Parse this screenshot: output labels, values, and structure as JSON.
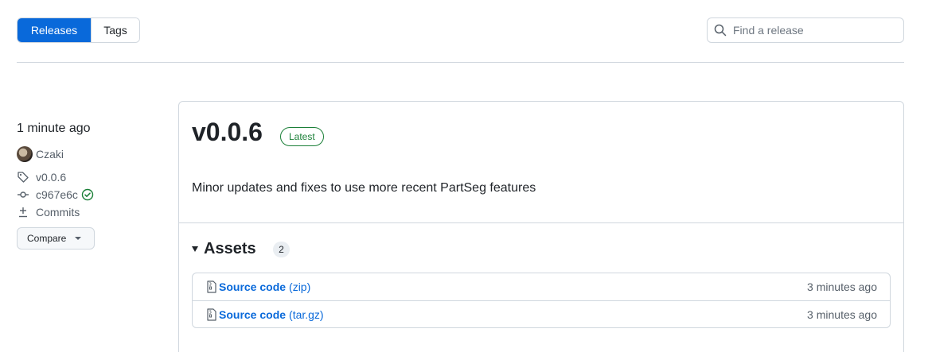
{
  "tabs": {
    "releases": "Releases",
    "tags": "Tags"
  },
  "search": {
    "placeholder": "Find a release"
  },
  "meta": {
    "time": "1 minute ago",
    "author": "Czaki",
    "tag": "v0.0.6",
    "commit": "c967e6c",
    "commits_label": "Commits",
    "compare_label": "Compare"
  },
  "release": {
    "version": "v0.0.6",
    "badge": "Latest",
    "description": "Minor updates and fixes to use more recent PartSeg features"
  },
  "assets": {
    "title": "Assets",
    "count": "2",
    "items": [
      {
        "name": "Source code",
        "ext": "(zip)",
        "time": "3 minutes ago"
      },
      {
        "name": "Source code",
        "ext": "(tar.gz)",
        "time": "3 minutes ago"
      }
    ]
  },
  "colors": {
    "accent": "#0969da",
    "success": "#1a7f37",
    "border": "#d0d7de",
    "muted": "#57606a"
  }
}
